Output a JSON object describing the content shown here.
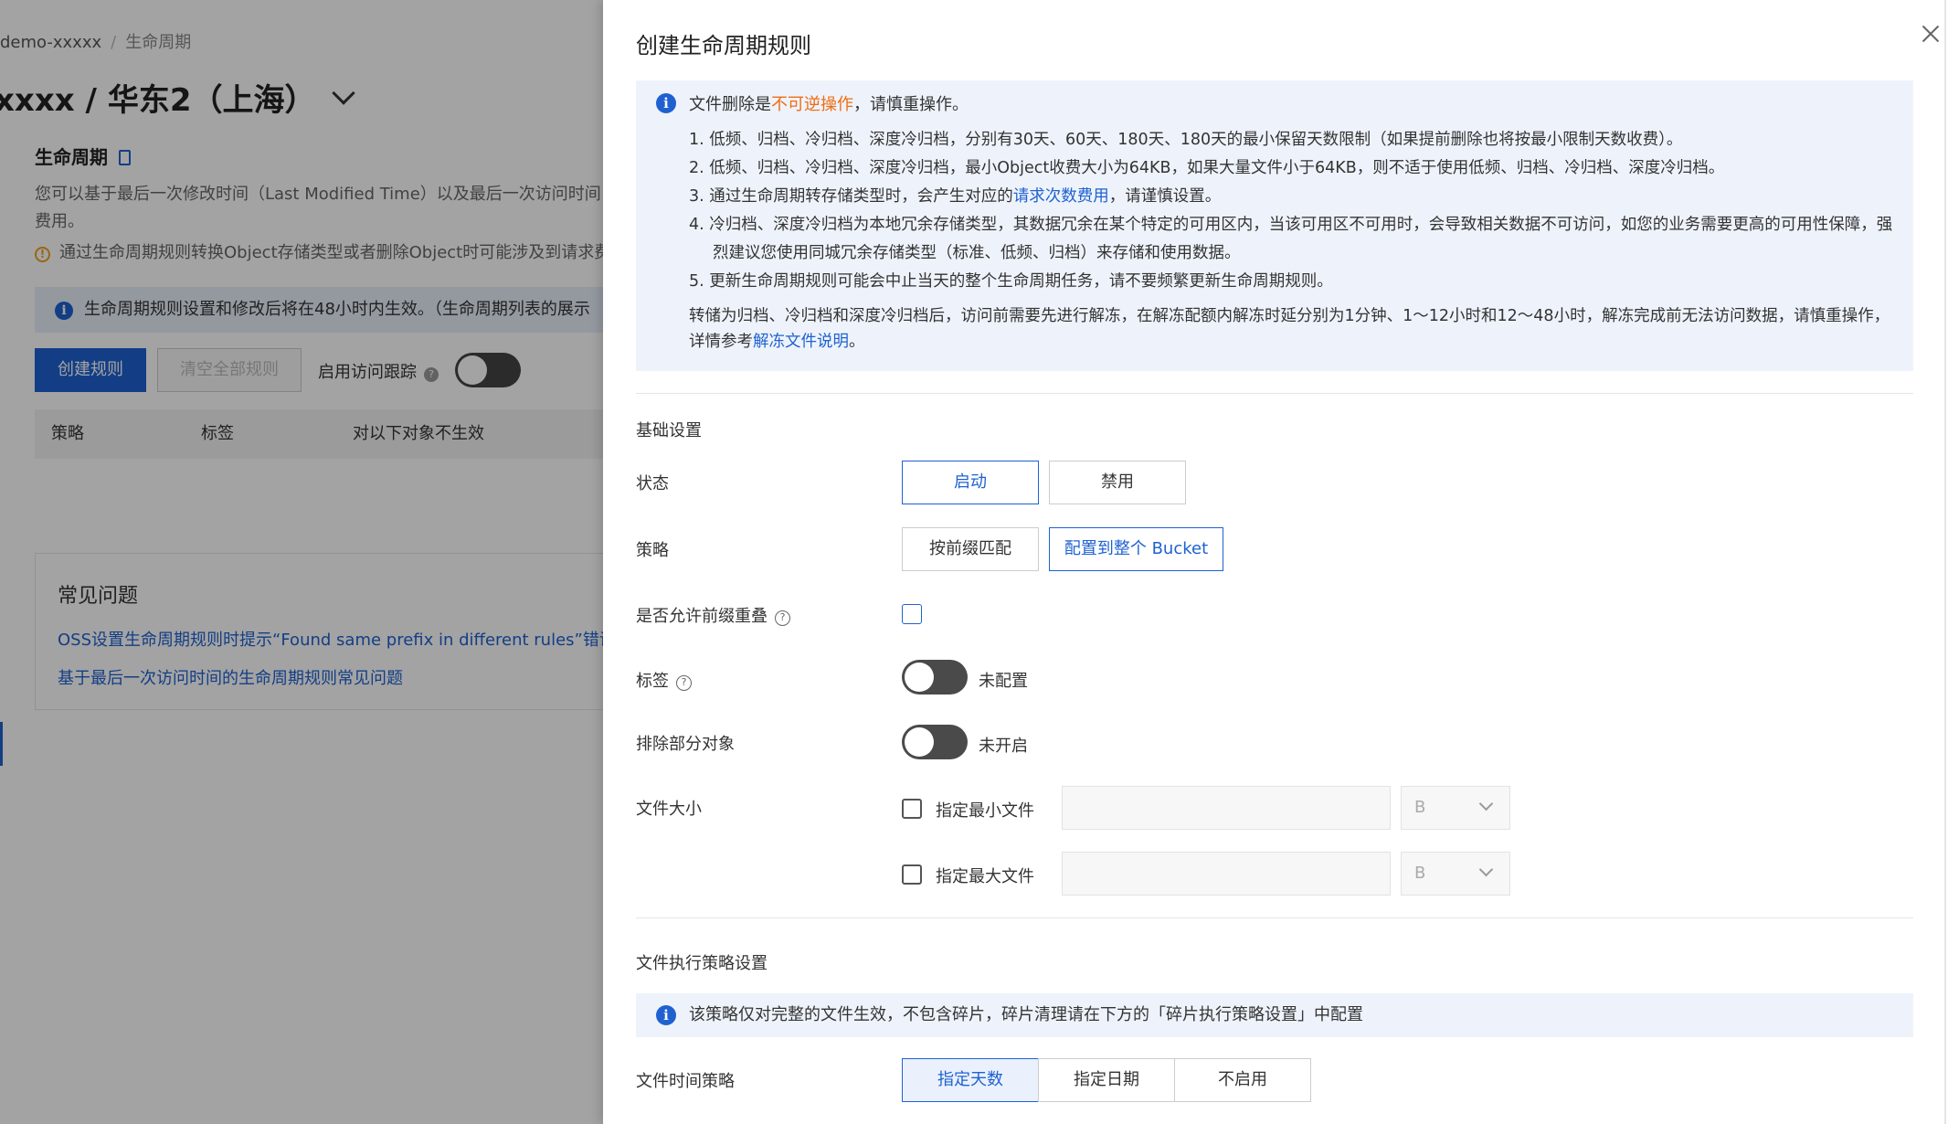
{
  "background": {
    "breadcrumb": {
      "root": "demo-xxxxx",
      "separator": "/",
      "current": "生命周期"
    },
    "bucket_title": "xxxx / 华东2（上海）",
    "section_title": "生命周期",
    "description": "您可以基于最后一次修改时间（Last Modified Time）以及最后一次访问时间 费用。",
    "warning_text": "通过生命周期规则转换Object存储类型或者删除Object时可能涉及到请求费",
    "notice_text": "生命周期规则设置和修改后将在48小时内生效。（生命周期列表的展示",
    "buttons": {
      "create": "创建规则",
      "clear_all": "清空全部规则"
    },
    "access_tracking_label": "启用访问跟踪",
    "table_headers": [
      "策略",
      "标签",
      "对以下对象不生效"
    ],
    "faq": {
      "title": "常见问题",
      "links": [
        "OSS设置生命周期规则时提示“Found same prefix in different rules”错误",
        "基于最后一次访问时间的生命周期规则常见问题"
      ]
    }
  },
  "drawer": {
    "title": "创建生命周期规则",
    "alert": {
      "head_pre": "文件删除是",
      "head_highlight": "不可逆操作",
      "head_post": "，请慎重操作。",
      "items": [
        {
          "text": "1. 低频、归档、冷归档、深度冷归档，分别有30天、60天、180天、180天的最小保留天数限制（如果提前删除也将按最小限制天数收费）。"
        },
        {
          "text": "2. 低频、归档、冷归档、深度冷归档，最小Object收费大小为64KB，如果大量文件小于64KB，则不适于使用低频、归档、冷归档、深度冷归档。"
        },
        {
          "pre": "3. 通过生命周期转存储类型时，会产生对应的",
          "highlight": "请求次数费用",
          "post": "，请谨慎设置。"
        },
        {
          "text": "4. 冷归档、深度冷归档为本地冗余存储类型，其数据冗余在某个特定的可用区内，当该可用区不可用时，会导致相关数据不可访问，如您的业务需要更高的可用性保障，强烈建议您使用同城冗余存储类型（标准、低频、归档）来存储和使用数据。"
        },
        {
          "text": "5. 更新生命周期规则可能会中止当天的整个生命周期任务，请不要频繁更新生命周期规则。"
        }
      ],
      "footer_pre": "转储为归档、冷归档和深度冷归档后，访问前需要先进行解冻，在解冻配额内解冻时延分别为1分钟、1～12小时和12～48小时，解冻完成前无法访问数据，请慎重操作，详情参考",
      "footer_link": "解冻文件说明",
      "footer_post": "。"
    },
    "basic_settings": {
      "title": "基础设置",
      "status": {
        "label": "状态",
        "options": [
          "启动",
          "禁用"
        ],
        "selected": "启动"
      },
      "policy": {
        "label": "策略",
        "options": [
          "按前缀匹配",
          "配置到整个 Bucket"
        ],
        "selected": "配置到整个 Bucket"
      },
      "allow_prefix_overlap": {
        "label": "是否允许前缀重叠",
        "checked": false
      },
      "tags": {
        "label": "标签",
        "state": "未配置",
        "on": false
      },
      "exclude_objects": {
        "label": "排除部分对象",
        "state": "未开启",
        "on": false
      },
      "file_size": {
        "label": "文件大小",
        "min_label": "指定最小文件",
        "max_label": "指定最大文件",
        "min_unit": "B",
        "max_unit": "B",
        "min_value": "",
        "max_value": ""
      }
    },
    "execution_settings": {
      "title": "文件执行策略设置",
      "info": "该策略仅对完整的文件生效，不包含碎片，碎片清理请在下方的「碎片执行策略设置」中配置",
      "time_policy": {
        "label": "文件时间策略",
        "options": [
          "指定天数",
          "指定日期",
          "不启用"
        ],
        "selected": "指定天数"
      }
    }
  },
  "colors": {
    "primary": "#1f61d1",
    "warning": "#f06c12",
    "alert_bg": "#eef3fb"
  }
}
